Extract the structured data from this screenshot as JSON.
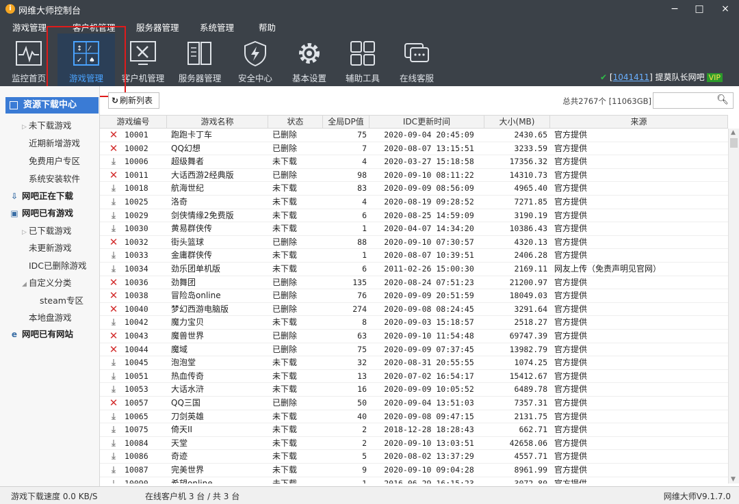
{
  "window": {
    "title": "网维大师控制台",
    "logo": "i",
    "minimize": "−",
    "maximize": "□",
    "close": "×"
  },
  "menu": [
    "游戏管理",
    "客户机管理",
    "服务器管理",
    "系统管理",
    "帮助"
  ],
  "toolbar": [
    {
      "label": "监控首页",
      "icon": "monitor-icon"
    },
    {
      "label": "游戏管理",
      "icon": "gamepad-icon",
      "active": true
    },
    {
      "label": "客户机管理",
      "icon": "tools-icon"
    },
    {
      "label": "服务器管理",
      "icon": "server-icon"
    },
    {
      "label": "安全中心",
      "icon": "shield-icon"
    },
    {
      "label": "基本设置",
      "icon": "gear-icon"
    },
    {
      "label": "辅助工具",
      "icon": "grid-icon"
    },
    {
      "label": "在线客服",
      "icon": "chat-icon"
    }
  ],
  "user": {
    "open": "[",
    "id": "1041411",
    "close": "]",
    "name": "提莫队长网吧",
    "badge": "VIP"
  },
  "sidebar": {
    "header": "资源下载中心",
    "items": [
      {
        "label": "未下载游戏",
        "indent": 1,
        "tri": "▷"
      },
      {
        "label": "近期新增游戏",
        "indent": 2
      },
      {
        "label": "免费用户专区",
        "indent": 2
      },
      {
        "label": "系统安装软件",
        "indent": 2
      },
      {
        "label": "网吧正在下载",
        "indent": 0,
        "bold": true,
        "icon": "⇩"
      },
      {
        "label": "网吧已有游戏",
        "indent": 0,
        "bold": true,
        "icon": "▣"
      },
      {
        "label": "已下载游戏",
        "indent": 1,
        "tri": "▷"
      },
      {
        "label": "未更新游戏",
        "indent": 2
      },
      {
        "label": "IDC已删除游戏",
        "indent": 2
      },
      {
        "label": "自定义分类",
        "indent": 1,
        "tri": "◢"
      },
      {
        "label": "steam专区",
        "indent": 3
      },
      {
        "label": "本地盘游戏",
        "indent": 2
      },
      {
        "label": "网吧已有网站",
        "indent": 0,
        "bold": true,
        "icon": "e"
      }
    ]
  },
  "actions": {
    "refresh": "刷新列表",
    "total": "总共2767个 [11063GB]",
    "search_placeholder": ""
  },
  "table": {
    "headers": [
      "游戏编号",
      "游戏名称",
      "状态",
      "全局DP值",
      "IDC更新时间",
      "大小(MB)",
      "来源"
    ],
    "rows": [
      [
        "del",
        "10001",
        "跑跑卡丁车",
        "已删除",
        "75",
        "2020-09-04 20:45:09",
        "2430.65",
        "官方提供"
      ],
      [
        "del",
        "10002",
        "QQ幻想",
        "已删除",
        "7",
        "2020-08-07 13:15:51",
        "3233.59",
        "官方提供"
      ],
      [
        "dl",
        "10006",
        "超级舞者",
        "未下载",
        "4",
        "2020-03-27 15:18:58",
        "17356.32",
        "官方提供"
      ],
      [
        "del",
        "10011",
        "大话西游2经典版",
        "已删除",
        "98",
        "2020-09-10 08:11:22",
        "14310.73",
        "官方提供"
      ],
      [
        "dl",
        "10018",
        "航海世纪",
        "未下载",
        "83",
        "2020-09-09 08:56:09",
        "4965.40",
        "官方提供"
      ],
      [
        "dl",
        "10025",
        "洛奇",
        "未下载",
        "4",
        "2020-08-19 09:28:52",
        "7271.85",
        "官方提供"
      ],
      [
        "dl",
        "10029",
        "剑侠情缘2免费版",
        "未下载",
        "6",
        "2020-08-25 14:59:09",
        "3190.19",
        "官方提供"
      ],
      [
        "dl",
        "10030",
        "黄易群侠传",
        "未下载",
        "1",
        "2020-04-07 14:34:20",
        "10386.43",
        "官方提供"
      ],
      [
        "del",
        "10032",
        "街头篮球",
        "已删除",
        "88",
        "2020-09-10 07:30:57",
        "4320.13",
        "官方提供"
      ],
      [
        "dl",
        "10033",
        "金庸群侠传",
        "未下载",
        "1",
        "2020-08-07 10:39:51",
        "2406.28",
        "官方提供"
      ],
      [
        "dl",
        "10034",
        "劲乐团单机版",
        "未下载",
        "6",
        "2011-02-26 15:00:30",
        "2169.11",
        "网友上传（免责声明见官网）"
      ],
      [
        "del",
        "10036",
        "劲舞团",
        "已删除",
        "135",
        "2020-08-24 07:51:23",
        "21200.97",
        "官方提供"
      ],
      [
        "del",
        "10038",
        "冒险岛online",
        "已删除",
        "76",
        "2020-09-09 20:51:59",
        "18049.03",
        "官方提供"
      ],
      [
        "del",
        "10040",
        "梦幻西游电脑版",
        "已删除",
        "274",
        "2020-09-08 08:24:45",
        "3291.64",
        "官方提供"
      ],
      [
        "dl",
        "10042",
        "魔力宝贝",
        "未下载",
        "8",
        "2020-09-03 15:18:57",
        "2518.27",
        "官方提供"
      ],
      [
        "del",
        "10043",
        "魔兽世界",
        "已删除",
        "63",
        "2020-09-10 11:54:48",
        "69747.39",
        "官方提供"
      ],
      [
        "del",
        "10044",
        "魔域",
        "已删除",
        "75",
        "2020-09-09 07:37:45",
        "13982.79",
        "官方提供"
      ],
      [
        "dl",
        "10045",
        "泡泡堂",
        "未下载",
        "32",
        "2020-08-31 20:55:55",
        "1074.25",
        "官方提供"
      ],
      [
        "dl",
        "10051",
        "热血传奇",
        "未下载",
        "13",
        "2020-07-02 16:54:17",
        "15412.67",
        "官方提供"
      ],
      [
        "dl",
        "10053",
        "大话水浒",
        "未下载",
        "16",
        "2020-09-09 10:05:52",
        "6489.78",
        "官方提供"
      ],
      [
        "del",
        "10057",
        "QQ三国",
        "已删除",
        "50",
        "2020-09-04 13:51:03",
        "7357.31",
        "官方提供"
      ],
      [
        "dl",
        "10065",
        "刀剑英雄",
        "未下载",
        "40",
        "2020-09-08 09:47:15",
        "2131.75",
        "官方提供"
      ],
      [
        "dl",
        "10075",
        "倚天II",
        "未下载",
        "2",
        "2018-12-28 18:28:43",
        "662.71",
        "官方提供"
      ],
      [
        "dl",
        "10084",
        "天堂",
        "未下载",
        "2",
        "2020-09-10 13:03:51",
        "42658.06",
        "官方提供"
      ],
      [
        "dl",
        "10086",
        "奇迹",
        "未下载",
        "5",
        "2020-08-02 13:37:29",
        "4557.71",
        "官方提供"
      ],
      [
        "dl",
        "10087",
        "完美世界",
        "未下载",
        "9",
        "2020-09-10 09:04:28",
        "8961.99",
        "官方提供"
      ],
      [
        "dl",
        "10090",
        "希望online",
        "未下载",
        "1",
        "2016-06-29 16:15:23",
        "3072.80",
        "官方提供"
      ]
    ]
  },
  "status": {
    "speed": "游戏下载速度 0.0 KB/S",
    "clients": "在线客户机 3 台 / 共 3 台",
    "version": "网维大师V9.1.7.0"
  },
  "colors": {
    "chrome": "#3b4148",
    "active_tool": "#2b3f57",
    "accent": "#3a7bd5",
    "delete": "#d32f2f",
    "highlight_box": "#e01b1b"
  }
}
